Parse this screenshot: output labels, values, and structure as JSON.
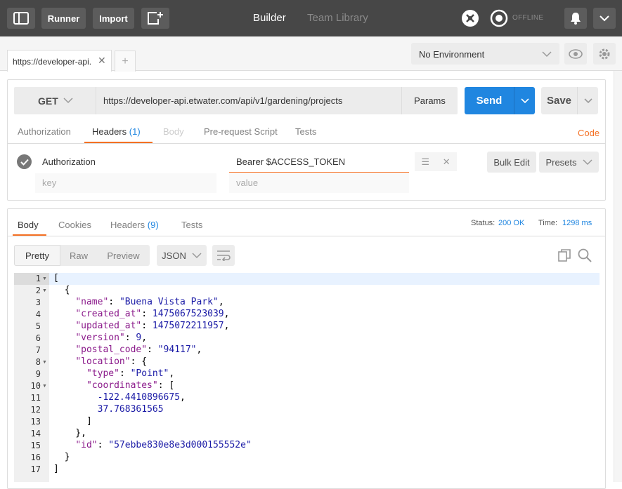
{
  "topbar": {
    "runner_label": "Runner",
    "import_label": "Import",
    "builder_label": "Builder",
    "team_library_label": "Team Library",
    "offline_label": "OFFLINE"
  },
  "tabs": {
    "active_tab_label": "https://developer-api.",
    "add_tab_label": "+"
  },
  "environment": {
    "selected": "No Environment"
  },
  "request": {
    "method": "GET",
    "url": "https://developer-api.etwater.com/api/v1/gardening/projects",
    "params_label": "Params",
    "send_label": "Send",
    "save_label": "Save",
    "subtabs": {
      "authorization": "Authorization",
      "headers": "Headers",
      "headers_count": "(1)",
      "body": "Body",
      "prerequest": "Pre-request Script",
      "tests": "Tests"
    },
    "code_label": "Code",
    "headers": [
      {
        "key": "Authorization",
        "value": "Bearer $ACCESS_TOKEN"
      }
    ],
    "key_placeholder": "key",
    "value_placeholder": "value",
    "bulk_edit_label": "Bulk Edit",
    "presets_label": "Presets"
  },
  "response": {
    "tabs": {
      "body": "Body",
      "cookies": "Cookies",
      "headers": "Headers",
      "headers_count": "(9)",
      "tests": "Tests"
    },
    "status_label": "Status:",
    "status_value": "200 OK",
    "time_label": "Time:",
    "time_value": "1298 ms",
    "format": {
      "pretty": "Pretty",
      "raw": "Raw",
      "preview": "Preview",
      "language": "JSON"
    },
    "line_numbers": [
      "1",
      "2",
      "3",
      "4",
      "5",
      "6",
      "7",
      "8",
      "9",
      "10",
      "11",
      "12",
      "13",
      "14",
      "15",
      "16",
      "17"
    ]
  },
  "colors": {
    "accent_orange": "#f47023",
    "send_blue": "#2086e0",
    "topbar_bg": "#474747"
  }
}
